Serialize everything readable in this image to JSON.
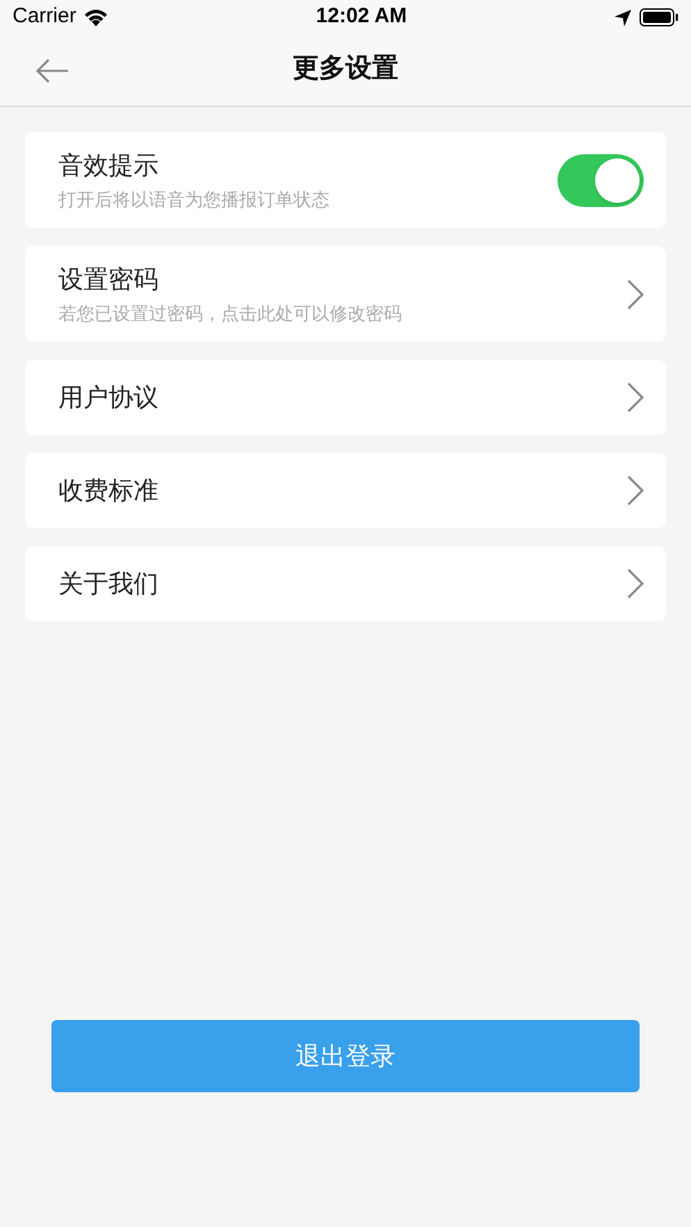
{
  "status_bar": {
    "carrier": "Carrier",
    "time": "12:02 AM"
  },
  "nav": {
    "title": "更多设置"
  },
  "items": [
    {
      "kind": "toggle",
      "title": "音效提示",
      "subtitle": "打开后将以语音为您播报订单状态",
      "on": true
    },
    {
      "kind": "link",
      "title": "设置密码",
      "subtitle": "若您已设置过密码，点击此处可以修改密码"
    },
    {
      "kind": "link",
      "title": "用户协议"
    },
    {
      "kind": "link",
      "title": "收费标准"
    },
    {
      "kind": "link",
      "title": "关于我们"
    }
  ],
  "logout_button": "退出登录"
}
